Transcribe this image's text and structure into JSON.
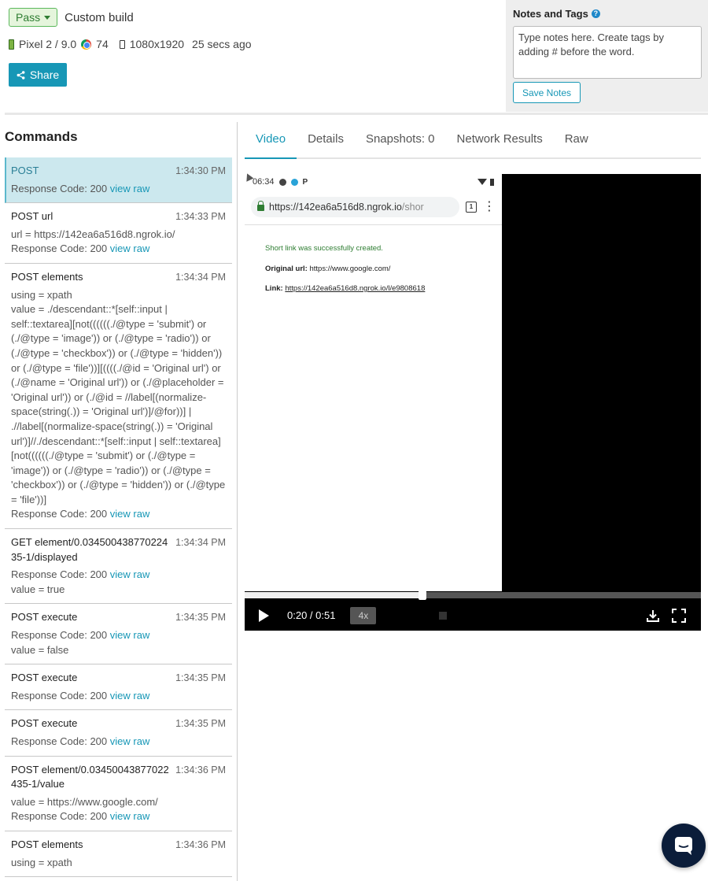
{
  "header": {
    "status_label": "Pass",
    "build_name": "Custom build",
    "device": "Pixel 2 / 9.0",
    "browser_version": "74",
    "resolution": "1080x1920",
    "time_ago": "25 secs ago",
    "share_label": "Share"
  },
  "notes": {
    "title": "Notes and Tags",
    "help": "?",
    "placeholder": "Type notes here. Create tags by adding # before the word.",
    "save_label": "Save Notes"
  },
  "commands": {
    "title": "Commands",
    "items": [
      {
        "name": "POST",
        "time": "1:34:30 PM",
        "lines": [],
        "response": "Response Code: 200",
        "link": "view raw",
        "after": []
      },
      {
        "name": "POST url",
        "time": "1:34:33 PM",
        "lines": [
          "url = https://142ea6a516d8.ngrok.io/"
        ],
        "response": "Response Code: 200",
        "link": "view raw",
        "after": []
      },
      {
        "name": "POST elements",
        "time": "1:34:34 PM",
        "lines": [
          "using = xpath",
          "value = ./descendant::*[self::input | self::textarea][not((((((./@type = 'submit') or (./@type = 'image')) or (./@type = 'radio')) or (./@type = 'checkbox')) or (./@type = 'hidden')) or (./@type = 'file'))][((((./@id = 'Original url') or (./@name = 'Original url')) or (./@placeholder = 'Original url')) or (./@id = //label[(normalize-space(string(.)) = 'Original url')]/@for))] | .//label[(normalize-space(string(.)) = 'Original url')]//./descendant::*[self::input | self::textarea][not((((((./@type = 'submit') or (./@type = 'image')) or (./@type = 'radio')) or (./@type = 'checkbox')) or (./@type = 'hidden')) or (./@type = 'file'))]"
        ],
        "response": "Response Code: 200",
        "link": "view raw",
        "after": []
      },
      {
        "name": "GET element/0.03450043877022435-1/displayed",
        "time": "1:34:34 PM",
        "lines": [],
        "response": "Response Code: 200",
        "link": "view raw",
        "after": [
          "value = true"
        ]
      },
      {
        "name": "POST execute",
        "time": "1:34:35 PM",
        "lines": [],
        "response": "Response Code: 200",
        "link": "view raw",
        "after": [
          "value = false"
        ]
      },
      {
        "name": "POST execute",
        "time": "1:34:35 PM",
        "lines": [],
        "response": "Response Code: 200",
        "link": "view raw",
        "after": []
      },
      {
        "name": "POST execute",
        "time": "1:34:35 PM",
        "lines": [],
        "response": "Response Code: 200",
        "link": "view raw",
        "after": []
      },
      {
        "name": "POST element/0.03450043877022435-1/value",
        "time": "1:34:36 PM",
        "lines": [
          "value = https://www.google.com/"
        ],
        "response": "Response Code: 200",
        "link": "view raw",
        "after": []
      },
      {
        "name": "POST elements",
        "time": "1:34:36 PM",
        "lines": [
          "using = xpath"
        ],
        "response": "",
        "link": "",
        "after": []
      }
    ]
  },
  "tabs": [
    "Video",
    "Details",
    "Snapshots: 0",
    "Network Results",
    "Raw"
  ],
  "video": {
    "status_time": "06:34",
    "url_main": "https://142ea6a516d8.ngrok.io",
    "url_rest": "/shor",
    "tab_count": "1",
    "success_text": "Short link was successfully created.",
    "original_label": "Original url:",
    "original_value": "https://www.google.com/",
    "link_label": "Link:",
    "link_value": "https://142ea6a516d8.ngrok.io/l/e9808618",
    "time": "0:20 / 0:51",
    "speed": "4x",
    "progress": 0.39
  }
}
